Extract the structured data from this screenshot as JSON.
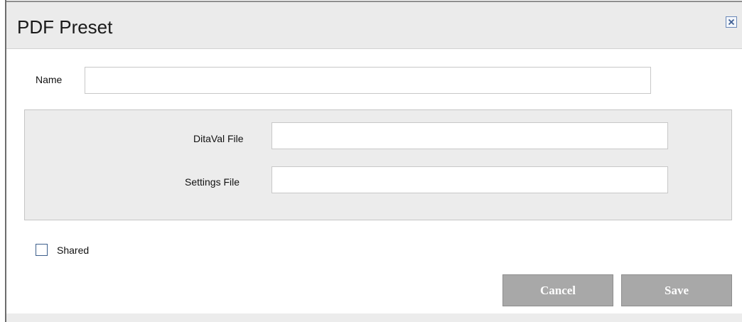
{
  "dialog": {
    "title": "PDF Preset",
    "close_icon": "close-icon"
  },
  "form": {
    "name_label": "Name",
    "name_value": "",
    "ditaval_label": "DitaVal File",
    "ditaval_value": "",
    "settings_label": "Settings File",
    "settings_value": "",
    "shared_label": "Shared",
    "shared_checked": false
  },
  "buttons": {
    "cancel_label": "Cancel",
    "save_label": "Save"
  },
  "colors": {
    "title_bar": "#ebebeb",
    "panel": "#ececec",
    "button": "#a8a8a8",
    "checkbox_border": "#3d5f8c"
  }
}
